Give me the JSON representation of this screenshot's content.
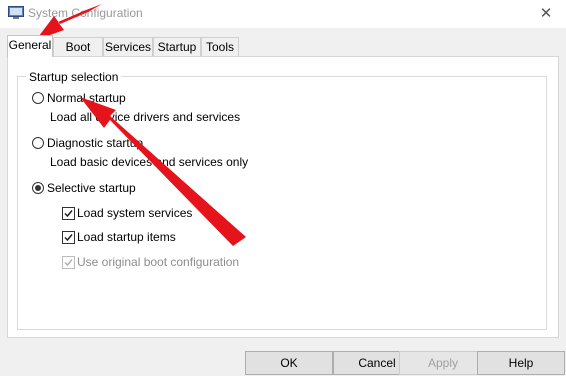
{
  "window": {
    "title": "System Configuration",
    "close_glyph": "✕"
  },
  "tabs": [
    {
      "label": "General",
      "active": true
    },
    {
      "label": "Boot",
      "active": false
    },
    {
      "label": "Services",
      "active": false
    },
    {
      "label": "Startup",
      "active": false
    },
    {
      "label": "Tools",
      "active": false
    }
  ],
  "startup_selection": {
    "label": "Startup selection",
    "options": [
      {
        "label": "Normal startup",
        "description": "Load all device drivers and services",
        "selected": false
      },
      {
        "label": "Diagnostic startup",
        "description": "Load basic devices and services only",
        "selected": false
      },
      {
        "label": "Selective startup",
        "selected": true
      }
    ],
    "checkboxes": [
      {
        "label": "Load system services",
        "checked": true,
        "enabled": true
      },
      {
        "label": "Load startup items",
        "checked": true,
        "enabled": true
      },
      {
        "label": "Use original boot configuration",
        "checked": true,
        "enabled": false
      }
    ]
  },
  "buttons": {
    "ok": "OK",
    "cancel": "Cancel",
    "apply": "Apply",
    "help": "Help"
  },
  "annotation": {
    "arrow_color": "#e5131c"
  },
  "icons": [
    "system-config-icon",
    "close-icon",
    "radio-icon",
    "checkbox-icon",
    "red-arrow-icon"
  ]
}
